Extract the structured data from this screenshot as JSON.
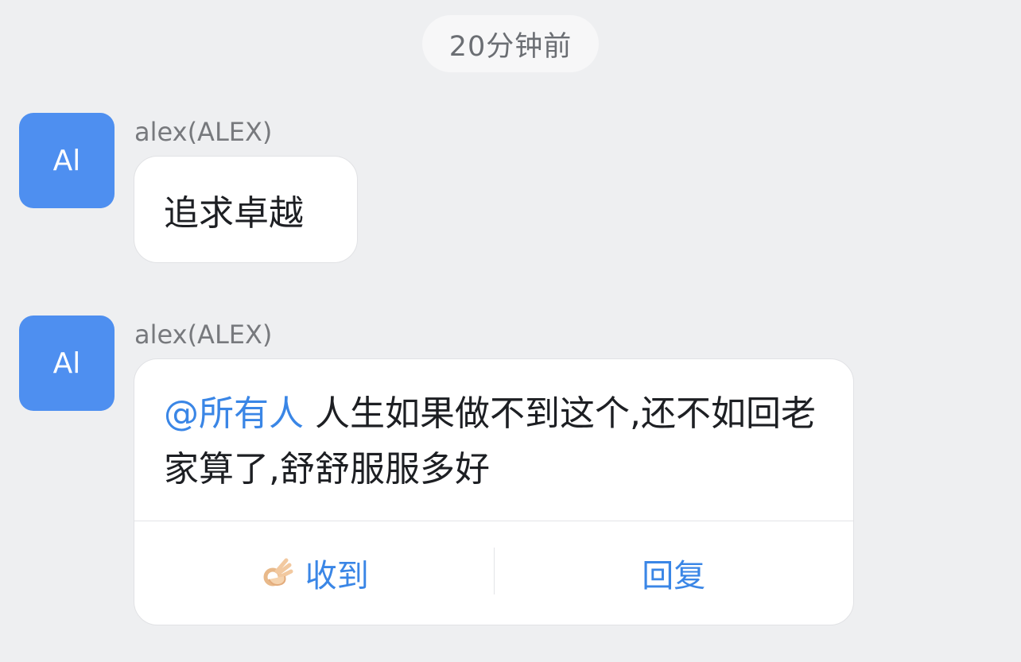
{
  "timestamp": "20分钟前",
  "messages": [
    {
      "avatar_text": "Al",
      "sender": "alex(ALEX)",
      "text": "追求卓越"
    },
    {
      "avatar_text": "Al",
      "sender": "alex(ALEX)",
      "mention": "@所有人",
      "text": " 人生如果做不到这个,还不如回老家算了,舒舒服服多好",
      "actions": {
        "ack_icon": "ok-hand-icon",
        "ack_label": "收到",
        "reply_label": "回复"
      }
    }
  ],
  "colors": {
    "background": "#EEEFF1",
    "avatar": "#4E8FF0",
    "accent": "#3A86E6",
    "bubble": "#FFFFFF"
  }
}
